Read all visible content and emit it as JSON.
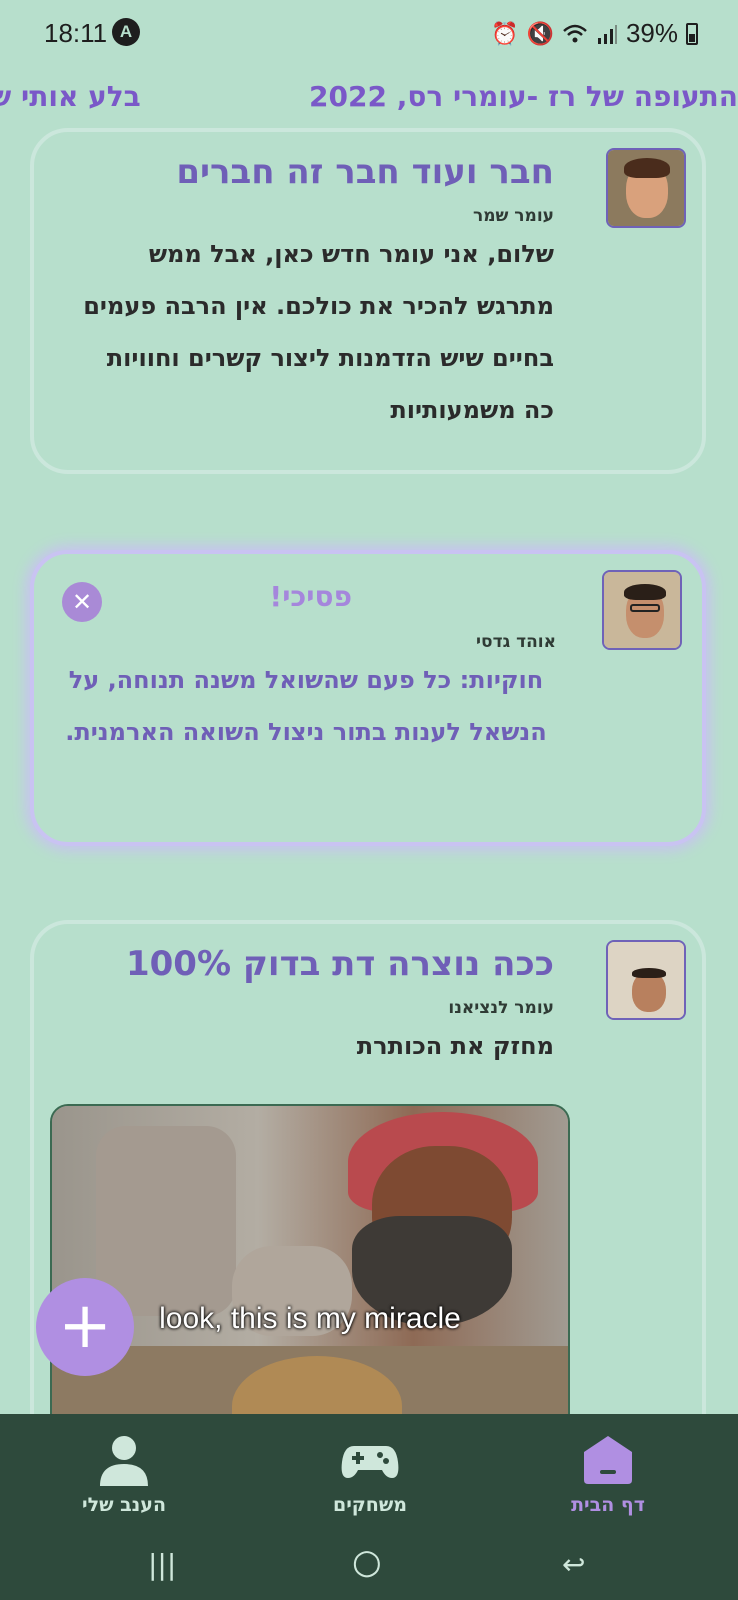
{
  "status_bar": {
    "time": "18:11",
    "notification_badge": "A",
    "battery": "39%",
    "icons": [
      "alarm-icon",
      "mute-icon",
      "wifi-icon",
      "signal-icon",
      "battery-icon"
    ]
  },
  "ticker": {
    "item_1": "התעופה של רז -עומרי רס, 2022",
    "item_2": "בלע אותי ש"
  },
  "posts": [
    {
      "title": "חבר ועוד חבר זה חברים",
      "author": "עומר שמר",
      "body": "שלום, אני עומר חדש כאן, אבל ממש מתרגש להכיר את כולכם. אין הרבה פעמים בחיים שיש הזדמנות ליצור קשרים וחוויות כה משמעותיות"
    },
    {
      "title": "פסיכי!",
      "author": "אוהד גדסי",
      "body": "חוקיות: כל פעם שהשואל משנה תנוחה, על הנשאל לענות בתור ניצול השואה הארמנית.",
      "close_icon": "close-icon"
    },
    {
      "title": "ככה נוצרה דת בדוק 100%",
      "author": "עומר לנציאנו",
      "body": "מחזק את הכותרת",
      "image_caption": "look, this is my miracle"
    }
  ],
  "fab": {
    "label": "+"
  },
  "bottom_nav": {
    "items": [
      {
        "label": "דף הבית",
        "icon": "home-icon",
        "active": true
      },
      {
        "label": "משחקים",
        "icon": "gamepad-icon",
        "active": false
      },
      {
        "label": "הענב שלי",
        "icon": "person-icon",
        "active": false
      }
    ]
  },
  "system_nav": {
    "recents": "|||",
    "home": "○",
    "back": "↩"
  },
  "colors": {
    "background": "#b7dfcc",
    "accent_purple": "#b08fe2",
    "title_purple": "#6f5fb7",
    "nav_bar": "#2e4a3c"
  }
}
